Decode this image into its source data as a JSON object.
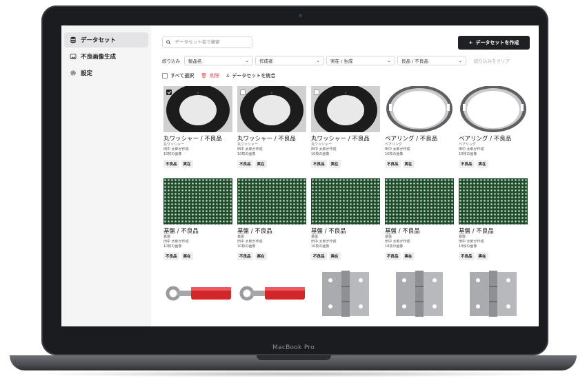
{
  "device": {
    "label": "MacBook Pro"
  },
  "sidebar": {
    "items": [
      {
        "label": "データセット",
        "icon": "database-icon",
        "active": true
      },
      {
        "label": "不良画像生成",
        "icon": "image-icon",
        "active": false
      },
      {
        "label": "設定",
        "icon": "gear-icon",
        "active": false
      }
    ]
  },
  "search": {
    "placeholder": "データセット名で検索",
    "value": ""
  },
  "create_button": {
    "label": "データセットを作成",
    "icon": "plus-icon"
  },
  "filters": {
    "label": "絞り込み",
    "selects": [
      {
        "value": "製品名"
      },
      {
        "value": "作成者"
      },
      {
        "value": "実在 / 生成"
      },
      {
        "value": "良品 / 不良品"
      }
    ],
    "clear_label": "絞り込みをクリア"
  },
  "actions": {
    "select_all": "すべて選択",
    "delete": "削除",
    "merge": "データセットを統合",
    "colors": {
      "delete": "#e5484d"
    }
  },
  "cards": [
    {
      "title": "丸ワッシャー / 不良品",
      "product": "丸ワッシャー",
      "author": "田中 太郎が作成",
      "count": "10枚の画像",
      "tags": [
        "不良品",
        "実在"
      ],
      "selected": true,
      "image": "washer"
    },
    {
      "title": "丸ワッシャー / 不良品",
      "product": "丸ワッシャー",
      "author": "田中 太郎が作成",
      "count": "10枚の画像",
      "tags": [
        "不良品",
        "実在"
      ],
      "selected": false,
      "image": "washer"
    },
    {
      "title": "丸ワッシャー / 不良品",
      "product": "丸ワッシャー",
      "author": "田中 太郎が作成",
      "count": "10枚の画像",
      "tags": [
        "不良品",
        "実在"
      ],
      "selected": false,
      "image": "washer"
    },
    {
      "title": "ベアリング / 不良品",
      "product": "ベアリング",
      "author": "田中 太郎が作成",
      "count": "10枚の画像",
      "tags": [
        "不良品",
        "実在"
      ],
      "selected": null,
      "image": "bearing"
    },
    {
      "title": "ベアリング / 不良品",
      "product": "ベアリング",
      "author": "田中 太郎が作成",
      "count": "10枚の画像",
      "tags": [
        "不良品",
        "実在"
      ],
      "selected": null,
      "image": "bearing"
    },
    {
      "title": "基盤 / 不良品",
      "product": "基盤",
      "author": "田中 太郎が作成",
      "count": "10枚の画像",
      "tags": [
        "不良品",
        "実在"
      ],
      "selected": null,
      "image": "pcb"
    },
    {
      "title": "基盤 / 不良品",
      "product": "基盤",
      "author": "田中 太郎が作成",
      "count": "10枚の画像",
      "tags": [
        "不良品",
        "実在"
      ],
      "selected": null,
      "image": "pcb"
    },
    {
      "title": "基盤 / 不良品",
      "product": "基盤",
      "author": "田中 太郎が作成",
      "count": "10枚の画像",
      "tags": [
        "不良品",
        "実在"
      ],
      "selected": null,
      "image": "pcb"
    },
    {
      "title": "基盤 / 不良品",
      "product": "基盤",
      "author": "田中 太郎が作成",
      "count": "10枚の画像",
      "tags": [
        "不良品",
        "実在"
      ],
      "selected": null,
      "image": "pcb"
    },
    {
      "title": "基盤 / 不良品",
      "product": "基盤",
      "author": "田中 太郎が作成",
      "count": "10枚の画像",
      "tags": [
        "不良品",
        "実在"
      ],
      "selected": null,
      "image": "pcb"
    },
    {
      "title": "",
      "product": "",
      "author": "",
      "count": "",
      "tags": [],
      "selected": null,
      "image": "terminal"
    },
    {
      "title": "",
      "product": "",
      "author": "",
      "count": "",
      "tags": [],
      "selected": null,
      "image": "terminal"
    },
    {
      "title": "",
      "product": "",
      "author": "",
      "count": "",
      "tags": [],
      "selected": null,
      "image": "hinge"
    },
    {
      "title": "",
      "product": "",
      "author": "",
      "count": "",
      "tags": [],
      "selected": null,
      "image": "hinge"
    },
    {
      "title": "",
      "product": "",
      "author": "",
      "count": "",
      "tags": [],
      "selected": null,
      "image": "hinge"
    }
  ]
}
